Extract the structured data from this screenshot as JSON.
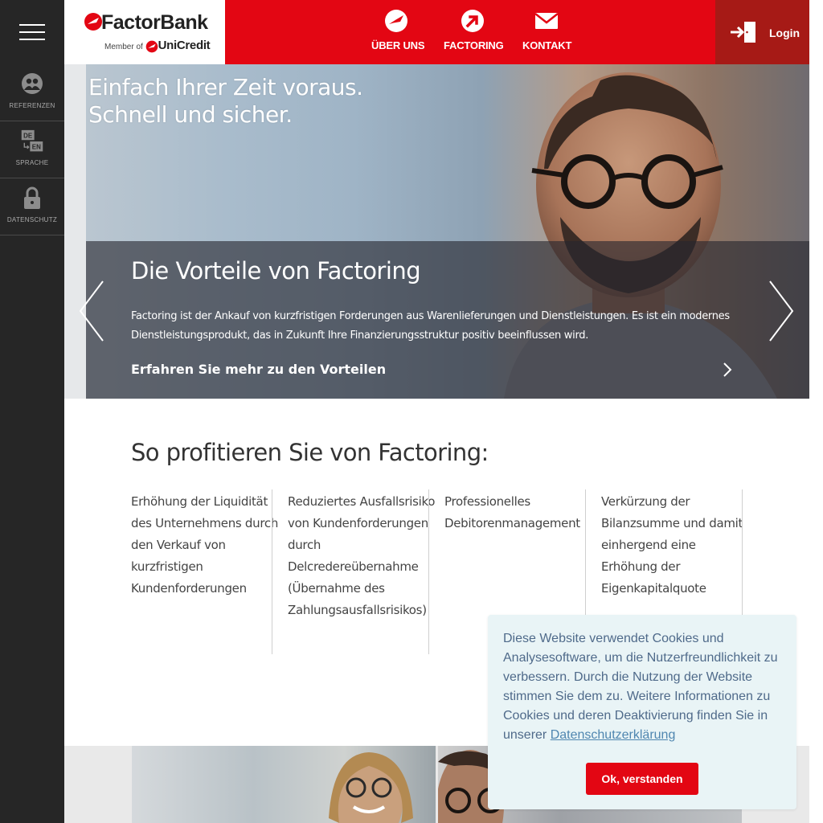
{
  "sidebar": {
    "menu_icon": "hamburger-icon",
    "items": [
      {
        "label": "REFERENZEN",
        "icon": "people-icon"
      },
      {
        "label": "SPRACHE",
        "icon": "language-switch-icon",
        "lang_primary": "DE",
        "lang_secondary": "EN"
      },
      {
        "label": "DATENSCHUTZ",
        "icon": "lock-icon"
      }
    ]
  },
  "header": {
    "logo": {
      "name": "FactorBank",
      "member_of": "Member of",
      "parent": "UniCredit"
    },
    "nav": [
      {
        "label": "ÜBER UNS",
        "icon": "unicredit-logo-icon"
      },
      {
        "label": "FACTORING",
        "icon": "arrow-up-right-icon"
      },
      {
        "label": "KONTAKT",
        "icon": "envelope-icon"
      }
    ],
    "login": {
      "label": "Login",
      "icon": "login-door-icon"
    }
  },
  "hero": {
    "headline_line1": "Einfach Ihrer Zeit voraus.",
    "headline_line2": "Schnell und sicher.",
    "slide_title": "Die Vorteile von Factoring",
    "slide_text": "Factoring ist der Ankauf von kurzfristigen Forderungen aus Warenlieferungen und Dienstleistungen. Es ist ein modernes Dienstleistungsprodukt, das in Zukunft Ihre Finanzierungsstruktur positiv beeinflussen wird.",
    "slide_link": "Erfahren Sie mehr zu den Vorteilen"
  },
  "benefits": {
    "title": "So profitieren Sie von Factoring:",
    "items": [
      "Erhöhung der Liquidität des Unternehmens durch den Verkauf von kurzfristigen Kundenforderungen",
      "Reduziertes Ausfallsrisiko von Kundenforderungen durch Delcredereübernahme (Übernahme des Zahlungsausfallsrisikos)",
      "Professionelles Debitorenmanagement",
      "Verkürzung der Bilanzsumme und damit einhergend eine Erhöhung der Eigenkapitalquote"
    ]
  },
  "cookie": {
    "text": "Diese Website verwendet Cookies und Analysesoftware, um die Nutzerfreundlichkeit zu verbessern. Durch die Nutzung der Website stimmen Sie dem zu. Weitere Informationen zu Cookies und deren Deaktivierung finden Sie in unserer ",
    "link": "Datenschutzerklärung",
    "button": "Ok, verstanden"
  },
  "colors": {
    "brand_red": "#e30613",
    "login_dark_red": "#a61a16",
    "sidebar": "#262626",
    "cookie_bg": "#e9f4f6",
    "cookie_text": "#4f6a8a"
  }
}
